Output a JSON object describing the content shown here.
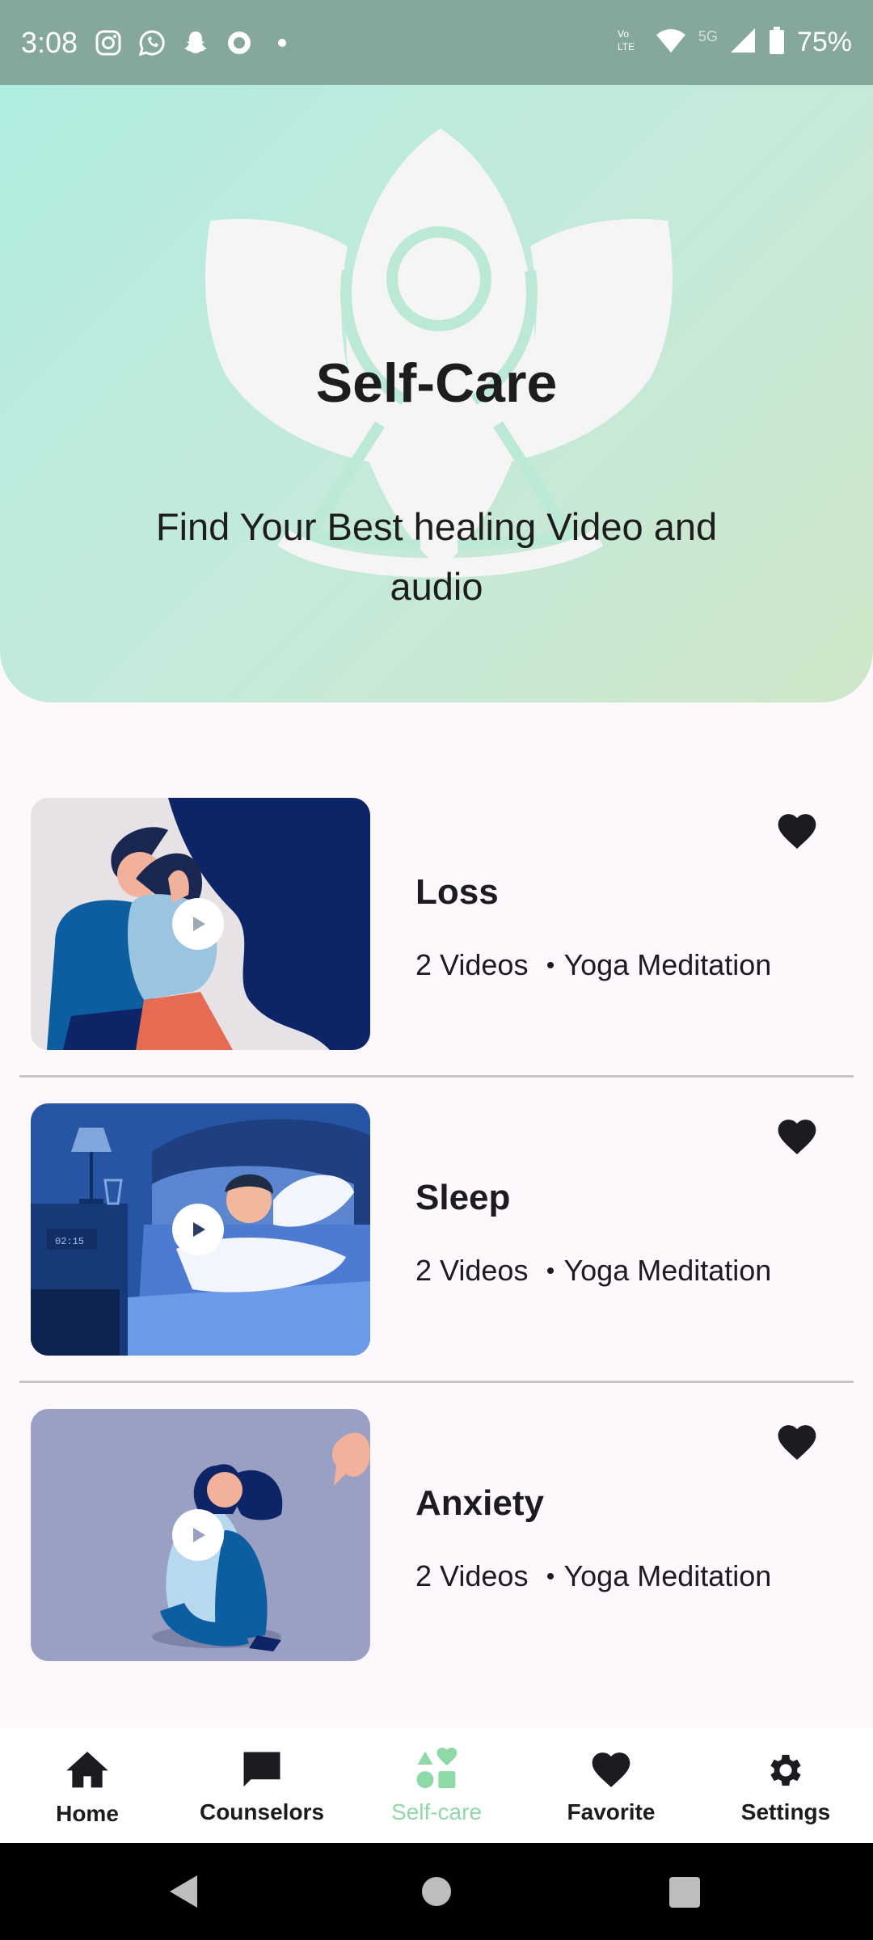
{
  "status_bar": {
    "time": "3:08",
    "battery": "75%",
    "network_label": "5G",
    "icons": [
      "instagram-icon",
      "whatsapp-icon",
      "snapchat-icon",
      "ring-icon",
      "volte-icon",
      "wifi-icon",
      "signal-icon",
      "battery-icon"
    ]
  },
  "hero": {
    "title": "Self-Care",
    "subtitle": "Find Your Best healing Video and audio"
  },
  "items": [
    {
      "title": "Loss",
      "count": "2 Videos",
      "category": "Yoga Meditation"
    },
    {
      "title": "Sleep",
      "count": "2 Videos",
      "category": "Yoga Meditation"
    },
    {
      "title": "Anxiety",
      "count": "2 Videos",
      "category": "Yoga Meditation"
    }
  ],
  "nav": {
    "home": "Home",
    "counselors": "Counselors",
    "selfcare": "Self-care",
    "favorite": "Favorite",
    "settings": "Settings",
    "active": "selfcare"
  },
  "colors": {
    "status_bar": "#86a89b",
    "hero_start": "#b0ece0",
    "hero_end": "#cfe6c8",
    "active_nav": "#8fd9a8"
  }
}
